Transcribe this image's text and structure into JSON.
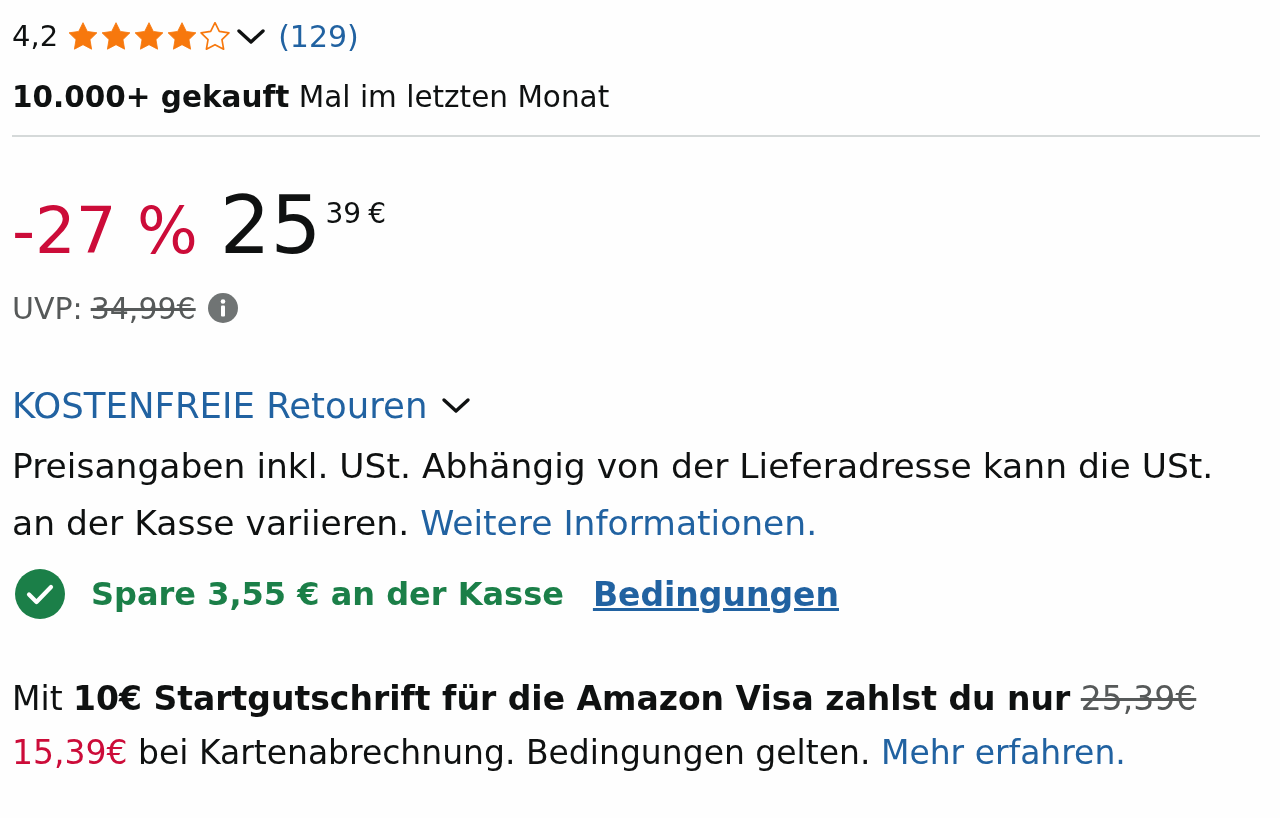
{
  "rating": {
    "value": "4,2",
    "stars": 4,
    "count": "(129)"
  },
  "purchases": "**10.000+ gekauft** Mal im letzten Monat",
  "price": {
    "discount": "-27 %",
    "whole": "25",
    "fraction": "39",
    "currency": "€"
  },
  "list_price": {
    "label": "UVP:",
    "value": "34,99€"
  },
  "returns": {
    "label": "KOSTENFREIE Retouren"
  },
  "tax_note": {
    "text": "Preisangaben inkl. USt. Abhängig von der Lieferadresse kann die USt. an der Kasse variieren.",
    "link": "Weitere Informationen."
  },
  "coupon": {
    "text": "Spare 3,55 € an der Kasse",
    "link": "Bedingungen"
  },
  "card_offer": {
    "intro": "Mit **10€ Startgutschrift für die Amazon Visa zahlst du nur**",
    "old_price": "25,39€",
    "new_price": "15,39€",
    "text": "bei Kartenabrechnung. Bedingungen gelten.",
    "link": "Mehr erfahren."
  }
}
